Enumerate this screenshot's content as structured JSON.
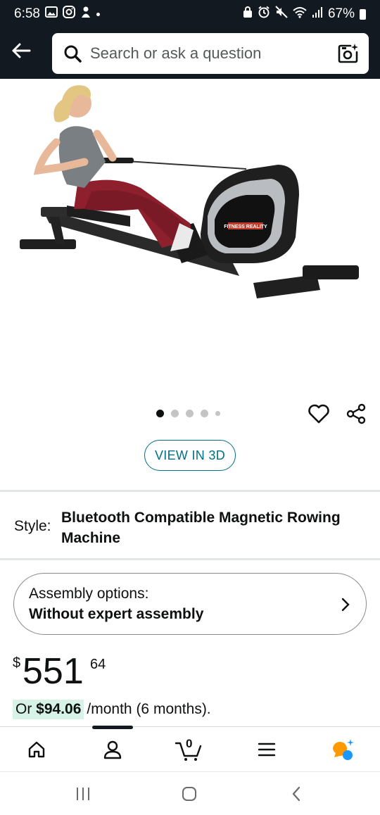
{
  "status_bar": {
    "time": "6:58",
    "battery": "67%",
    "left_icons": [
      "gallery-icon",
      "instagram-icon",
      "app-icon",
      "notification-dot"
    ],
    "right_icons": [
      "vpn-icon",
      "alarm-icon",
      "mute-icon",
      "wifi-icon",
      "signal-icon",
      "battery-icon"
    ]
  },
  "header": {
    "back_icon": "arrow-left-icon",
    "search_placeholder": "Search or ask a question",
    "camera_icon": "camera-search-icon"
  },
  "product_image": {
    "alt": "rowing-machine-photo",
    "brand_logo_text": "FITNESS REALITY"
  },
  "carousel": {
    "dot_count": 5,
    "active_index": 0
  },
  "actions": {
    "wishlist_icon": "heart-icon",
    "share_icon": "share-icon",
    "view_3d_label": "VIEW IN 3D"
  },
  "style": {
    "label": "Style:",
    "value": "Bluetooth Compatible Magnetic Rowing Machine"
  },
  "assembly": {
    "title": "Assembly options:",
    "value": "Without expert assembly"
  },
  "price": {
    "symbol": "$",
    "whole": "551",
    "fraction": "64"
  },
  "monthly": {
    "prefix": "Or ",
    "amount": "$94.06",
    "rest": "/month (6 months)."
  },
  "bottom_nav": {
    "items": [
      "home-icon",
      "account-icon",
      "cart-icon",
      "menu-icon",
      "rufus-icon"
    ],
    "cart_count": "0",
    "active_index": 1
  },
  "system_nav": [
    "recents-button",
    "home-button",
    "back-button"
  ],
  "colors": {
    "header_bg": "#131921",
    "link": "#007185",
    "highlight": "#d7f3e8",
    "rufus_orange": "#ff9900",
    "rufus_blue": "#1a98ff"
  }
}
